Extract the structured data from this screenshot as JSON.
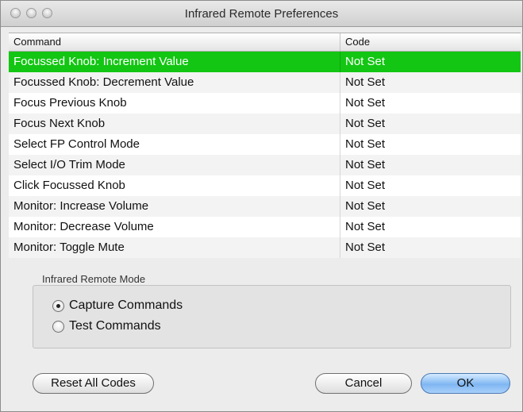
{
  "window": {
    "title": "Infrared Remote Preferences"
  },
  "table": {
    "headers": {
      "command": "Command",
      "code": "Code"
    },
    "rows": [
      {
        "command": "Focussed Knob: Increment Value",
        "code": "Not Set",
        "selected": true
      },
      {
        "command": "Focussed Knob: Decrement Value",
        "code": "Not Set"
      },
      {
        "command": "Focus Previous Knob",
        "code": "Not Set"
      },
      {
        "command": "Focus Next Knob",
        "code": "Not Set"
      },
      {
        "command": "Select FP Control Mode",
        "code": "Not Set"
      },
      {
        "command": "Select I/O Trim Mode",
        "code": "Not Set"
      },
      {
        "command": "Click Focussed Knob",
        "code": "Not Set"
      },
      {
        "command": "Monitor: Increase Volume",
        "code": "Not Set"
      },
      {
        "command": "Monitor: Decrease Volume",
        "code": "Not Set"
      },
      {
        "command": "Monitor: Toggle Mute",
        "code": "Not Set"
      }
    ]
  },
  "mode_group": {
    "label": "Infrared Remote Mode",
    "options": [
      {
        "label": "Capture Commands",
        "selected": true
      },
      {
        "label": "Test Commands",
        "selected": false
      }
    ]
  },
  "buttons": {
    "reset": "Reset All Codes",
    "cancel": "Cancel",
    "ok": "OK"
  },
  "colors": {
    "selection": "#13c613",
    "default_button": "#7fb6f2"
  }
}
